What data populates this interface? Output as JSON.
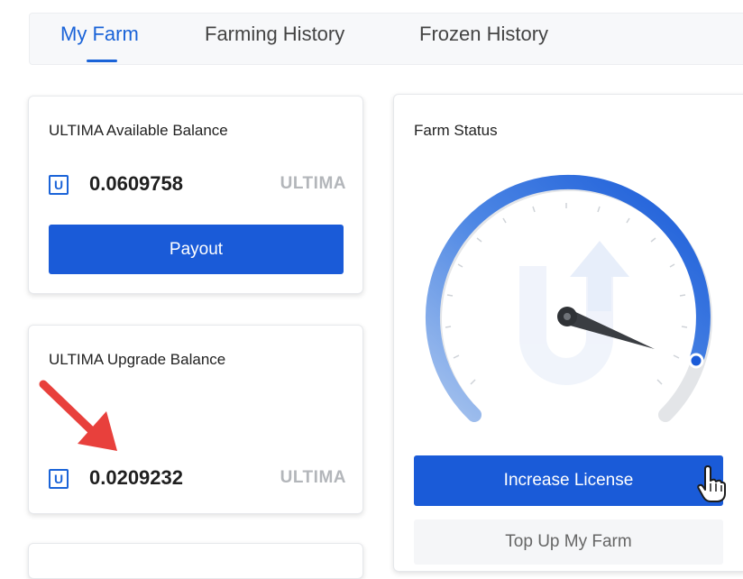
{
  "tabs": [
    {
      "label": "My Farm",
      "active": true
    },
    {
      "label": "Farming History",
      "active": false
    },
    {
      "label": "Frozen History",
      "active": false
    }
  ],
  "available": {
    "title": "ULTIMA Available Balance",
    "amount": "0.0609758",
    "unit": "ULTIMA",
    "payout_label": "Payout"
  },
  "upgrade": {
    "title": "ULTIMA Upgrade Balance",
    "amount": "0.0209232",
    "unit": "ULTIMA"
  },
  "farm_status": {
    "title": "Farm Status",
    "gauge_level": 0.9,
    "increase_label": "Increase License",
    "topup_label": "Top Up My Farm"
  },
  "icons": {
    "coin": "ultima-coin-icon",
    "annotation": "red-arrow-icon",
    "cursor": "hand-pointer-icon",
    "watermark": "ultima-logo-icon"
  },
  "colors": {
    "primary": "#1a5bd8",
    "arrow": "#e8403c",
    "muted_unit": "#b3b6ba"
  }
}
